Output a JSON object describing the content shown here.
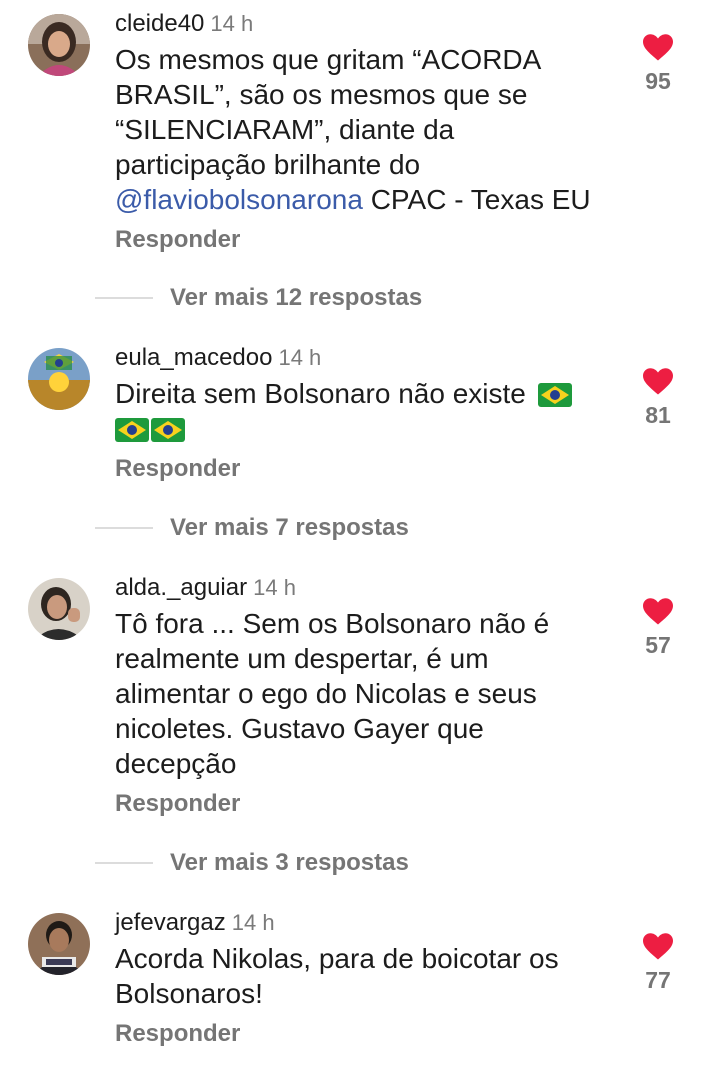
{
  "comments": [
    {
      "username": "cleide40",
      "time": "14 h",
      "lines": [
        "Os mesmos que gritam “ACORDA",
        "BRASIL”, são os mesmos que se",
        "“SILENCIARAM”, diante da",
        "participação brilhante do"
      ],
      "mention": "@flaviobolsonarona",
      "mention_tail": " CPAC - Texas EU",
      "reply_label": "Responder",
      "likes": "95",
      "more_replies": "Ver mais 12 respostas"
    },
    {
      "username": "eula_macedoo",
      "time": "14 h",
      "lines": [
        "Direita sem Bolsonaro não existe"
      ],
      "flags_line1": 1,
      "flags_line2": 2,
      "reply_label": "Responder",
      "likes": "81",
      "more_replies": "Ver mais 7 respostas"
    },
    {
      "username": "alda._aguiar",
      "time": "14 h",
      "lines": [
        "Tô fora ... Sem os Bolsonaro não é",
        "realmente um despertar, é um",
        "alimentar o  ego do Nicolas e seus",
        "nicoletes. Gustavo Gayer que",
        "decepção"
      ],
      "reply_label": "Responder",
      "likes": "57",
      "more_replies": "Ver mais 3 respostas"
    },
    {
      "username": "jefevargaz",
      "time": "14 h",
      "lines": [
        "Acorda Nikolas, para de boicotar os",
        "Bolsonaros!"
      ],
      "reply_label": "Responder",
      "likes": "77"
    }
  ],
  "icons": {
    "like": "heart-icon",
    "flag": "brazil-flag-emoji"
  },
  "colors": {
    "heart": "#ed1e42",
    "mention": "#3b5ba9",
    "secondary_text": "#757575"
  }
}
